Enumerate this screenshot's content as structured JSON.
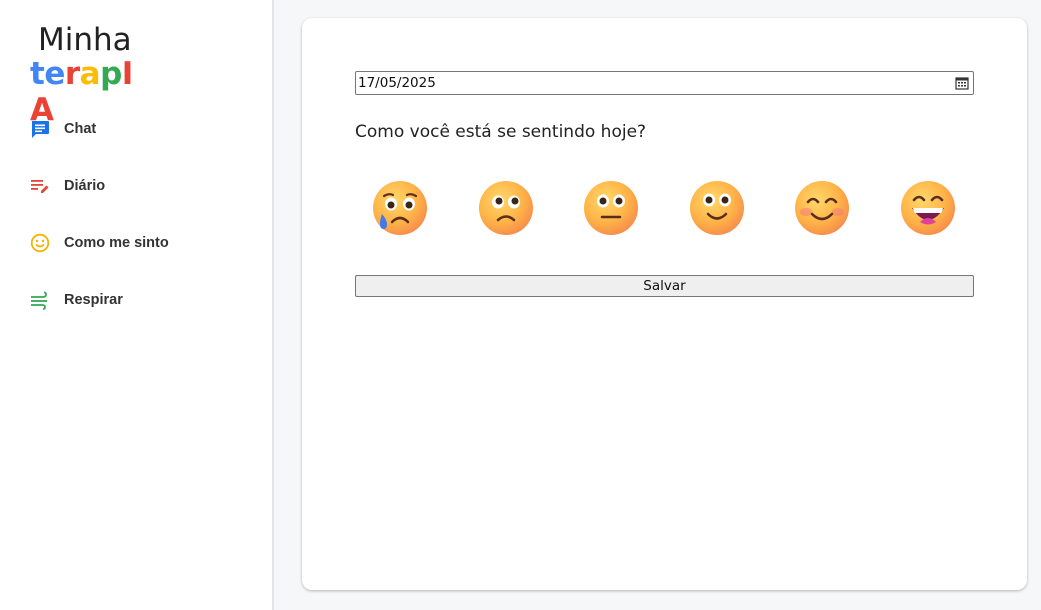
{
  "app": {
    "logo_line1": "Minha",
    "logo_line2": [
      "t",
      "e",
      "r",
      "a",
      "p",
      "I",
      "A"
    ],
    "logo_colors": [
      "#4285f4",
      "#4285f4",
      "#ea4335",
      "#fbbc05",
      "#34a853",
      "#ea4335",
      "#ea4335"
    ]
  },
  "sidebar": {
    "items": [
      {
        "label": "Chat",
        "icon": "chat-bubble-icon",
        "color": "#1a73e8"
      },
      {
        "label": "Diário",
        "icon": "edit-notes-icon",
        "color": "#e0463a"
      },
      {
        "label": "Como me sinto",
        "icon": "smiley-icon",
        "color": "#f4b400"
      },
      {
        "label": "Respirar",
        "icon": "wind-icon",
        "color": "#34a853"
      }
    ]
  },
  "main": {
    "date_value": "17/05/2025",
    "question": "Como você está se sentindo hoje?",
    "moods": [
      {
        "icon": "sad-tear-emoji-icon"
      },
      {
        "icon": "worried-emoji-icon"
      },
      {
        "icon": "neutral-emoji-icon"
      },
      {
        "icon": "slight-smile-emoji-icon"
      },
      {
        "icon": "blush-smile-emoji-icon"
      },
      {
        "icon": "grin-emoji-icon"
      }
    ],
    "save_label": "Salvar"
  }
}
